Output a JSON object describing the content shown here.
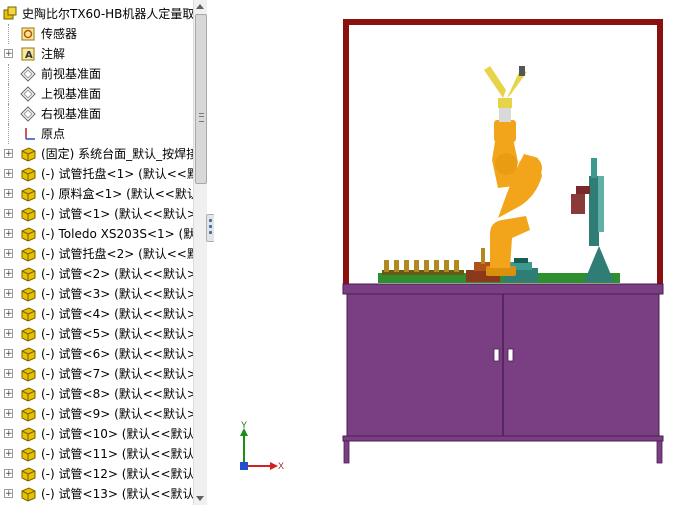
{
  "tree": {
    "rows": [
      {
        "label": "史陶比尔TX60-HB机器人定量取",
        "icon": "assembly-icon",
        "expander": "none"
      },
      {
        "label": "传感器",
        "icon": "sensor-icon",
        "expander": "tree-line"
      },
      {
        "label": "注解",
        "icon": "annotation-icon",
        "expander": "plus"
      },
      {
        "label": "前视基准面",
        "icon": "plane-icon",
        "expander": "tree-line"
      },
      {
        "label": "上视基准面",
        "icon": "plane-icon",
        "expander": "tree-line"
      },
      {
        "label": "右视基准面",
        "icon": "plane-icon",
        "expander": "tree-line"
      },
      {
        "label": "原点",
        "icon": "origin-icon",
        "expander": "tree-line"
      },
      {
        "label": "(固定) 系统台面_默认_按焊接",
        "icon": "part-icon",
        "expander": "plus"
      },
      {
        "label": "(-) 试管托盘<1> (默认<<默",
        "icon": "part-icon",
        "expander": "plus"
      },
      {
        "label": "(-) 原料盒<1> (默认<<默认",
        "icon": "part-icon",
        "expander": "plus"
      },
      {
        "label": "(-) 试管<1> (默认<<默认>",
        "icon": "part-icon",
        "expander": "plus"
      },
      {
        "label": "(-) Toledo XS203S<1> (默",
        "icon": "part-icon",
        "expander": "plus"
      },
      {
        "label": "(-) 试管托盘<2> (默认<<默",
        "icon": "part-icon",
        "expander": "plus"
      },
      {
        "label": "(-) 试管<2> (默认<<默认>",
        "icon": "part-icon",
        "expander": "plus"
      },
      {
        "label": "(-) 试管<3> (默认<<默认>",
        "icon": "part-icon",
        "expander": "plus"
      },
      {
        "label": "(-) 试管<4> (默认<<默认>",
        "icon": "part-icon",
        "expander": "plus"
      },
      {
        "label": "(-) 试管<5> (默认<<默认>",
        "icon": "part-icon",
        "expander": "plus"
      },
      {
        "label": "(-) 试管<6> (默认<<默认>",
        "icon": "part-icon",
        "expander": "plus"
      },
      {
        "label": "(-) 试管<7> (默认<<默认>",
        "icon": "part-icon",
        "expander": "plus"
      },
      {
        "label": "(-) 试管<8> (默认<<默认>",
        "icon": "part-icon",
        "expander": "plus"
      },
      {
        "label": "(-) 试管<9> (默认<<默认>",
        "icon": "part-icon",
        "expander": "plus"
      },
      {
        "label": "(-) 试管<10> (默认<<默认",
        "icon": "part-icon",
        "expander": "plus"
      },
      {
        "label": "(-) 试管<11> (默认<<默认",
        "icon": "part-icon",
        "expander": "plus"
      },
      {
        "label": "(-) 试管<12> (默认<<默认",
        "icon": "part-icon",
        "expander": "plus"
      },
      {
        "label": "(-) 试管<13> (默认<<默认",
        "icon": "part-icon",
        "expander": "plus"
      }
    ]
  },
  "viewport": {
    "triad": {
      "x_label": "X",
      "y_label": "Y"
    },
    "colors": {
      "frame": "#8b1010",
      "cabinet": "#7a3f82",
      "cabinet_edge": "#4a1f52",
      "robot": "#f2a51a",
      "gripper": "#e6d44a",
      "base_plate": "#2e8f2e",
      "stand": "#2f7d75",
      "tube": "#b08a20"
    }
  }
}
